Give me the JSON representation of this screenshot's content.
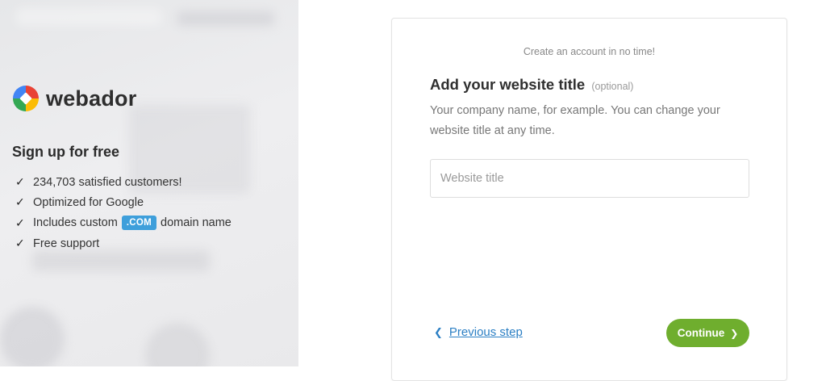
{
  "brand": {
    "name": "webador"
  },
  "sidebar": {
    "title": "Sign up for free",
    "features": [
      {
        "text": "234,703 satisfied customers!"
      },
      {
        "text": "Optimized for Google"
      },
      {
        "before": "Includes custom",
        "badge": ".COM",
        "after": "domain name"
      },
      {
        "text": "Free support"
      }
    ],
    "check_glyph": "✓"
  },
  "card": {
    "subtitle": "Create an account in no time!",
    "title": "Add your website title",
    "optional": "(optional)",
    "description": "Your company name, for example. You can change your website title at any time.",
    "input": {
      "placeholder": "Website title",
      "value": ""
    },
    "previous_label": "Previous step",
    "continue_label": "Continue"
  },
  "colors": {
    "accent_green": "#6fae2e",
    "link_blue": "#2b7fc4",
    "badge_blue": "#3e9fdb"
  }
}
